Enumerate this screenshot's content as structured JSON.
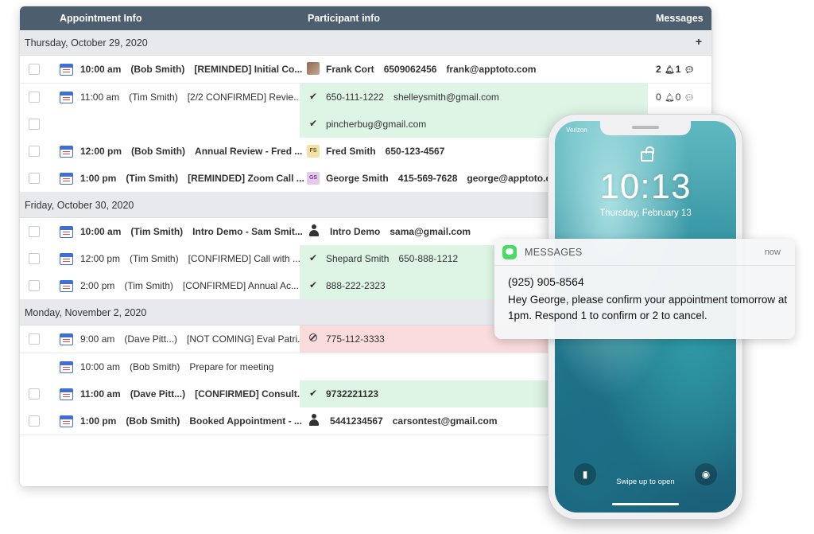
{
  "header": {
    "col_appointment": "Appointment Info",
    "col_participant": "Participant info",
    "col_messages": "Messages"
  },
  "sections": [
    {
      "title": "Thursday, October 29, 2020",
      "action": "+"
    },
    {
      "title": "Friday, October 30, 2020"
    },
    {
      "title": "Monday, November 2, 2020"
    }
  ],
  "rows": [
    {
      "time": "10:00 am",
      "staff": "(Bob Smith)",
      "desc": "[REMINDED] Initial Co...",
      "p1": "Frank Cort",
      "p2": "6509062456",
      "p3": "frank@apptoto.com",
      "msg_a": "2",
      "msg_b": "1"
    },
    {
      "time": "11:00 am",
      "staff": "(Tim Smith)",
      "desc": "[2/2 CONFIRMED] Revie...",
      "p1": "650-111-1222",
      "p2": "shelleysmith@gmail.com",
      "msg_a": "0",
      "msg_b": "0"
    },
    {
      "p1": "pincherbug@gmail.com"
    },
    {
      "time": "12:00 pm",
      "staff": "(Bob Smith)",
      "desc": "Annual Review - Fred ...",
      "badge": "FS",
      "p1": "Fred Smith",
      "p2": "650-123-4567"
    },
    {
      "time": "1:00 pm",
      "staff": "(Tim Smith)",
      "desc": "[REMINDED] Zoom Call ...",
      "badge": "GS",
      "p1": "George Smith",
      "p2": "415-569-7628",
      "p3": "george@apptoto.co"
    },
    {
      "time": "10:00 am",
      "staff": "(Tim Smith)",
      "desc": "Intro Demo - Sam Smit...",
      "p1": "Intro Demo",
      "p2": "sama@gmail.com"
    },
    {
      "time": "12:00 pm",
      "staff": "(Tim Smith)",
      "desc": "[CONFIRMED] Call with ...",
      "p1": "Shepard Smith",
      "p2": "650-888-1212"
    },
    {
      "time": "2:00 pm",
      "staff": "(Tim Smith)",
      "desc": "[CONFIRMED] Annual Ac...",
      "p1": "888-222-2323"
    },
    {
      "time": "9:00 am",
      "staff": "(Dave Pitt...)",
      "desc": "[NOT COMING] Eval Patri...",
      "p1": "775-112-3333"
    },
    {
      "time": "10:00 am",
      "staff": "(Bob Smith)",
      "desc": "Prepare for meeting"
    },
    {
      "time": "11:00 am",
      "staff": "(Dave Pitt...)",
      "desc": "[CONFIRMED] Consult...",
      "p1": "9732221123"
    },
    {
      "time": "1:00 pm",
      "staff": "(Bob Smith)",
      "desc": "Booked Appointment - ...",
      "p1": "5441234567",
      "p2": "carsontest@gmail.com"
    }
  ],
  "colors": {
    "header_bg": "#4d5f6f",
    "confirmed_bg": "#def4e5",
    "not_coming_bg": "#fadcdc",
    "messages_green": "#4cd964"
  },
  "phone": {
    "carrier": "Verizon",
    "time": "10:13",
    "date": "Thursday, February 13",
    "swipe_hint": "Swipe up to open"
  },
  "notification": {
    "app": "MESSAGES",
    "when": "now",
    "sender": "(925) 905-8564",
    "body": "Hey George, please confirm your appointment tomorrow at 1pm. Respond 1 to confirm or 2 to cancel."
  }
}
